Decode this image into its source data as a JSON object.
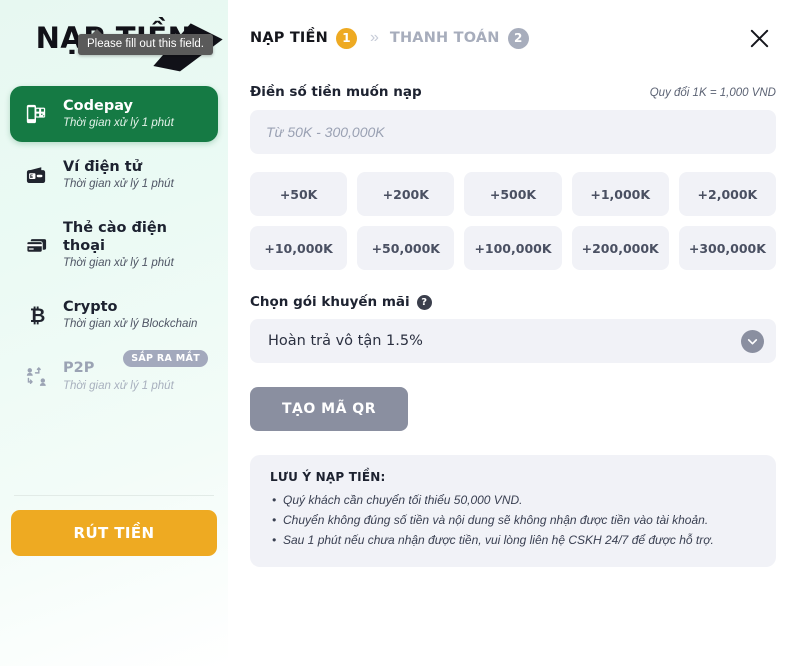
{
  "sidebar": {
    "logo": "NẠP TIỀN",
    "tooltip": "Please fill out this field.",
    "methods": [
      {
        "title": "Codepay",
        "subtitle": "Thời gian xử lý 1 phút",
        "icon": "qr-phone-icon",
        "state": "active"
      },
      {
        "title": "Ví điện tử",
        "subtitle": "Thời gian xử lý 1 phút",
        "icon": "wallet-icon",
        "state": "normal"
      },
      {
        "title": "Thẻ cào điện thoại",
        "subtitle": "Thời gian xử lý 1 phút",
        "icon": "cards-icon",
        "state": "normal"
      },
      {
        "title": "Crypto",
        "subtitle": "Thời gian xử lý Blockchain",
        "icon": "bitcoin-icon",
        "state": "normal"
      },
      {
        "title": "P2P",
        "subtitle": "Thời gian xử lý 1 phút",
        "icon": "p2p-icon",
        "state": "disabled",
        "badge": "SẮP RA MẮT"
      }
    ],
    "withdraw_label": "RÚT TIỀN"
  },
  "header": {
    "step1_label": "NẠP TIỀN",
    "step1_num": "1",
    "separator": "»",
    "step2_label": "THANH TOÁN",
    "step2_num": "2",
    "close_icon": "close-icon"
  },
  "form": {
    "amount_label": "Điền số tiền muốn nạp",
    "rate_note": "Quy đổi 1K = 1,000 VND",
    "amount_value": "",
    "amount_placeholder": "Từ 50K - 300,000K",
    "quick_amounts": [
      "+50K",
      "+200K",
      "+500K",
      "+1,000K",
      "+2,000K",
      "+10,000K",
      "+50,000K",
      "+100,000K",
      "+200,000K",
      "+300,000K"
    ],
    "promo_label": "Chọn gói khuyến mãi",
    "promo_help_icon": "help-icon",
    "promo_value": "Hoàn trả vô tận 1.5%",
    "promo_chevron_icon": "chevron-down-icon",
    "submit_label": "TẠO MÃ QR"
  },
  "notice": {
    "title": "LƯU Ý NẠP TIỀN:",
    "items": [
      "Quý khách cần chuyển tối thiểu 50,000 VND.",
      "Chuyển không đúng số tiền và nội dung sẽ không nhận được tiền vào tài khoản.",
      "Sau 1 phút nếu chưa nhận được tiền, vui lòng liên hệ CSKH 24/7 để được hỗ trợ."
    ]
  },
  "colors": {
    "accent_green": "#157a44",
    "accent_orange": "#eeaa22",
    "field_bg": "#f1f2f7",
    "muted": "#8a8fa0"
  }
}
